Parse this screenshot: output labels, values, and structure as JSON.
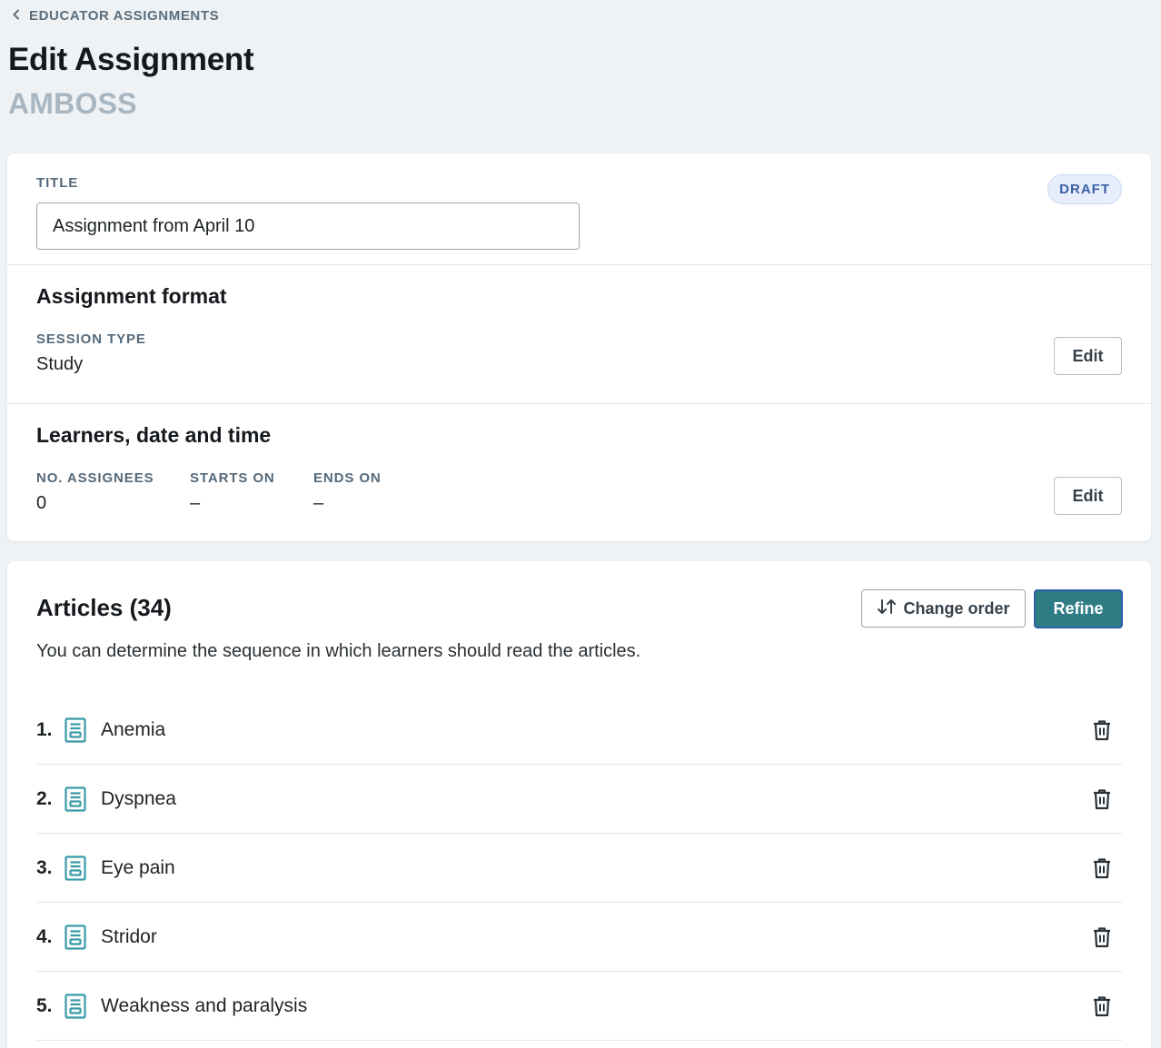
{
  "breadcrumb": {
    "label": "EDUCATOR ASSIGNMENTS",
    "icon": "chevron-left-icon"
  },
  "header": {
    "title": "Edit Assignment",
    "subtitle": "AMBOSS"
  },
  "assignment": {
    "title_label": "TITLE",
    "title_value": "Assignment from April 10",
    "status": "DRAFT"
  },
  "format": {
    "heading": "Assignment format",
    "session_type_label": "SESSION TYPE",
    "session_type_value": "Study",
    "edit_label": "Edit"
  },
  "learners": {
    "heading": "Learners, date and time",
    "assignees_label": "NO. ASSIGNEES",
    "assignees_value": "0",
    "starts_label": "STARTS ON",
    "starts_value": "–",
    "ends_label": "ENDS ON",
    "ends_value": "–",
    "edit_label": "Edit"
  },
  "articles": {
    "heading": "Articles (34)",
    "description": "You can determine the sequence in which learners should read the articles.",
    "change_order_label": "Change order",
    "refine_label": "Refine",
    "items": [
      {
        "number": "1.",
        "title": "Anemia"
      },
      {
        "number": "2.",
        "title": "Dyspnea"
      },
      {
        "number": "3.",
        "title": "Eye pain"
      },
      {
        "number": "4.",
        "title": "Stridor"
      },
      {
        "number": "5.",
        "title": "Weakness and paralysis"
      }
    ]
  },
  "colors": {
    "background": "#eef2f5",
    "accent": "#2f7c84",
    "article_icon": "#3a9aa6",
    "badge_text": "#3c5fa3",
    "muted_label": "#55697a"
  }
}
